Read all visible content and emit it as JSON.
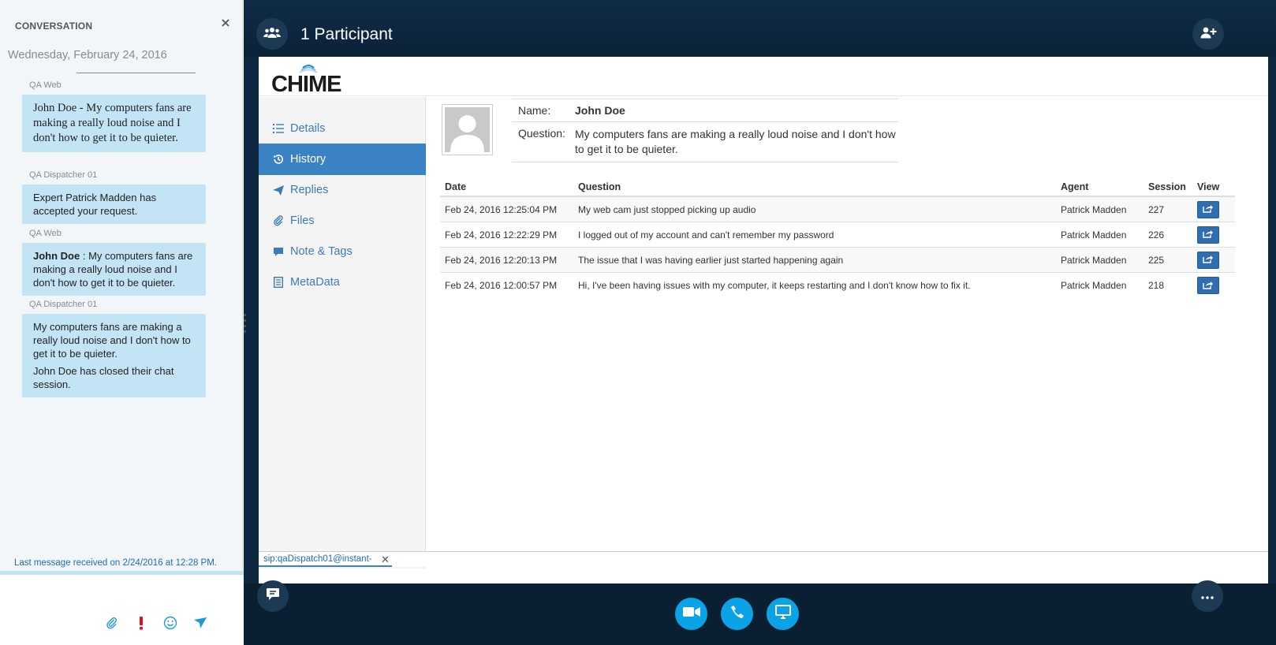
{
  "conversation": {
    "header": "CONVERSATION",
    "date": "Wednesday, February 24, 2016",
    "messages": [
      {
        "sender": "QA Web",
        "paragraphs": [
          "John Doe - My computers fans are making a really loud noise and I don't how to get it to be quieter."
        ]
      },
      {
        "sender": "QA Dispatcher 01",
        "paragraphs": [
          "Expert Patrick Madden has accepted your request."
        ]
      },
      {
        "sender": "QA Web",
        "bold_prefix": "John Doe",
        "text": " : My computers fans are making a really loud noise and I don't how to get it to be quieter."
      },
      {
        "sender": "QA Dispatcher 01",
        "paragraphs": [
          "My computers fans are making a really loud noise and I don't how to get it to be quieter.",
          "John Doe has closed their chat session."
        ]
      }
    ],
    "last_message": "Last message received on 2/24/2016 at 12:28 PM."
  },
  "frame": {
    "title": "1 Participant"
  },
  "app": {
    "logo_text": "CHIME",
    "nav": [
      {
        "label": "Details",
        "icon": "list-icon"
      },
      {
        "label": "History",
        "icon": "history-icon"
      },
      {
        "label": "Replies",
        "icon": "send-icon"
      },
      {
        "label": "Files",
        "icon": "paperclip-icon"
      },
      {
        "label": "Note & Tags",
        "icon": "comment-icon"
      },
      {
        "label": "MetaData",
        "icon": "document-icon"
      }
    ],
    "active_nav": "History",
    "profile": {
      "name_label": "Name:",
      "name": "John Doe",
      "question_label": "Question:",
      "question": "My computers fans are making a really loud noise and I don't how to get it to be quieter."
    },
    "history": {
      "columns": [
        "Date",
        "Question",
        "Agent",
        "Session",
        "View"
      ],
      "rows": [
        {
          "date": "Feb 24, 2016 12:25:04 PM",
          "question": "My web cam just stopped picking up audio",
          "agent": "Patrick Madden",
          "session": "227"
        },
        {
          "date": "Feb 24, 2016 12:22:29 PM",
          "question": "I logged out of my account and can't remember my password",
          "agent": "Patrick Madden",
          "session": "226"
        },
        {
          "date": "Feb 24, 2016 12:20:13 PM",
          "question": "The issue that I was having earlier just started happening again",
          "agent": "Patrick Madden",
          "session": "225"
        },
        {
          "date": "Feb 24, 2016 12:00:57 PM",
          "question": "Hi, I've been having issues with my computer, it keeps restarting and I don't know how to fix it.",
          "agent": "Patrick Madden",
          "session": "218"
        }
      ]
    },
    "tab": "sip:qaDispatch01@instant-"
  },
  "colors": {
    "frame_bg": "#0d2840",
    "bubble": "#c3e4f5",
    "accent": "#3b82c4",
    "call_button": "#0aa3e8"
  }
}
